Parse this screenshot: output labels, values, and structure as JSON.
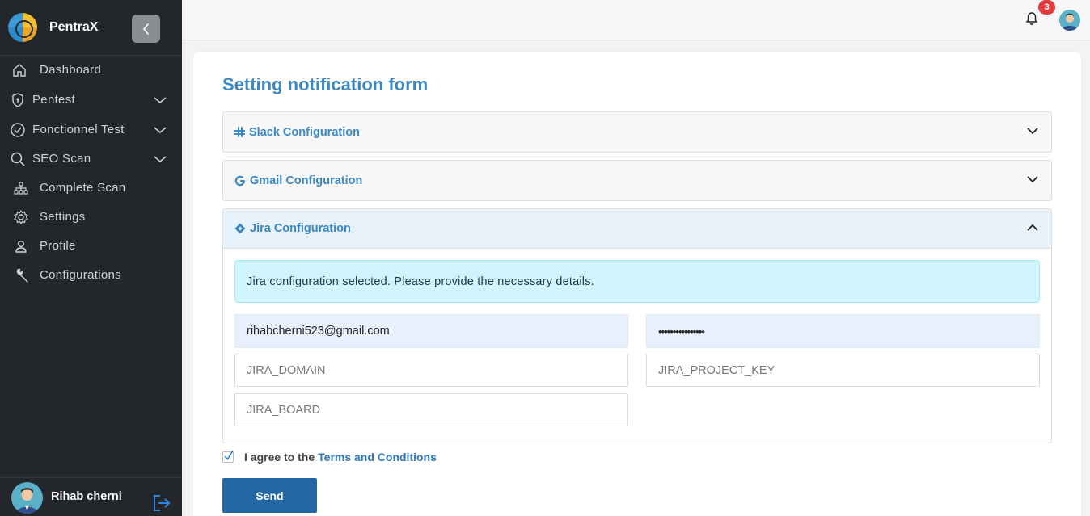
{
  "app": {
    "name": "PentraX"
  },
  "sidebar": {
    "items": [
      {
        "label": "Dashboard",
        "icon": "home-icon",
        "expandable": false
      },
      {
        "label": "Pentest",
        "icon": "shield-icon",
        "expandable": true
      },
      {
        "label": "Fonctionnel Test",
        "icon": "check-circle-icon",
        "expandable": true
      },
      {
        "label": "SEO Scan",
        "icon": "search-icon",
        "expandable": true
      },
      {
        "label": "Complete Scan",
        "icon": "sitemap-icon",
        "expandable": false
      },
      {
        "label": "Settings",
        "icon": "gear-icon",
        "expandable": false
      },
      {
        "label": "Profile",
        "icon": "user-icon",
        "expandable": false
      },
      {
        "label": "Configurations",
        "icon": "wrench-icon",
        "expandable": false
      }
    ],
    "user": {
      "name": "Rihab cherni"
    }
  },
  "topbar": {
    "notification_count": "3"
  },
  "main": {
    "title": "Setting notification form",
    "sections": [
      {
        "label": "Slack Configuration",
        "icon": "slack-icon",
        "open": false
      },
      {
        "label": "Gmail Configuration",
        "icon": "google-icon",
        "open": false
      },
      {
        "label": "Jira Configuration",
        "icon": "jira-diamond-icon",
        "open": true
      }
    ],
    "jira": {
      "alert": "Jira configuration selected. Please provide the necessary details.",
      "email_value": "rihabcherni523@gmail.com",
      "token_value": "••••••••••••••••",
      "domain_placeholder": "JIRA_DOMAIN",
      "project_key_placeholder": "JIRA_PROJECT_KEY",
      "board_placeholder": "JIRA_BOARD"
    },
    "agree": {
      "prefix": "I agree to the",
      "link": "Terms and Conditions",
      "checked": true
    },
    "send_label": "Send"
  },
  "colors": {
    "accent": "#3b87c2",
    "sidebar_bg": "#23272b",
    "button": "#2267a4",
    "badge": "#e23b40",
    "alert_bg": "#cff4fc"
  }
}
